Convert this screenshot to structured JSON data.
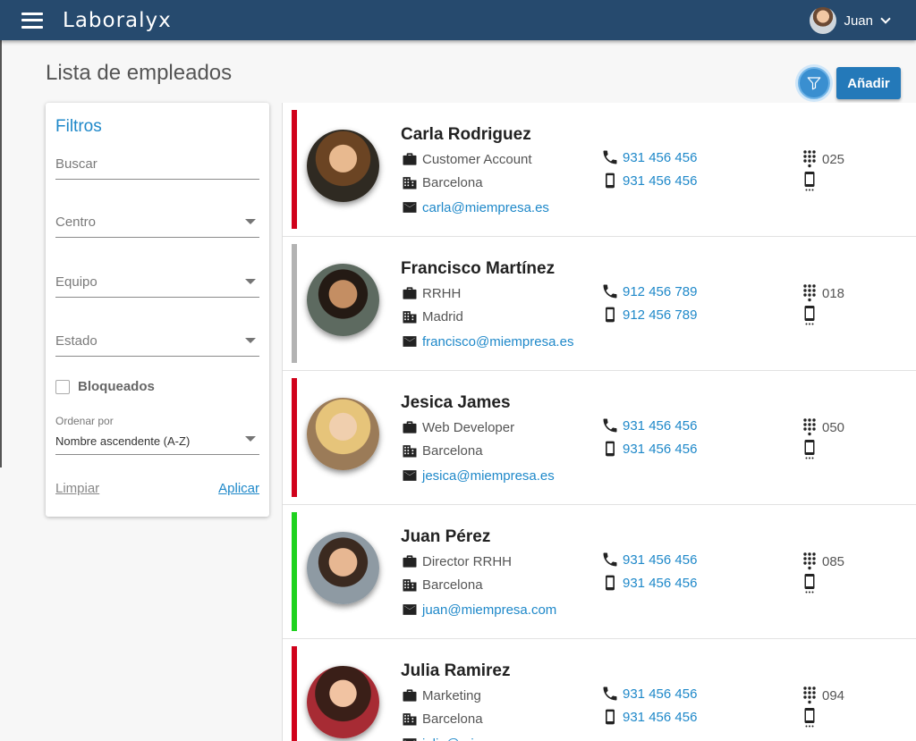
{
  "app": {
    "brand": "Laboralyx"
  },
  "user": {
    "name": "Juan"
  },
  "page": {
    "title": "Lista de empleados"
  },
  "actions": {
    "add_label": "Añadir"
  },
  "filters": {
    "title": "Filtros",
    "search_placeholder": "Buscar",
    "centro_placeholder": "Centro",
    "equipo_placeholder": "Equipo",
    "estado_placeholder": "Estado",
    "blocked_label": "Bloqueados",
    "sort_label": "Ordenar por",
    "sort_value": "Nombre ascendente (A-Z)",
    "clear_label": "Limpiar",
    "apply_label": "Aplicar"
  },
  "employees": [
    {
      "name": "Carla Rodriguez",
      "role": "Customer Account",
      "city": "Barcelona",
      "email": "carla@miempresa.es",
      "phone": "931 456 456",
      "mobile": "931 456 456",
      "ext": "025",
      "status_color": "#d0021b"
    },
    {
      "name": "Francisco Martínez",
      "role": "RRHH",
      "city": "Madrid",
      "email": "francisco@miempresa.es",
      "phone": "912 456 789",
      "mobile": "912 456 789",
      "ext": "018",
      "status_color": "#b3b3b3"
    },
    {
      "name": "Jesica James",
      "role": "Web Developer",
      "city": "Barcelona",
      "email": "jesica@miempresa.es",
      "phone": "931 456 456",
      "mobile": "931 456 456",
      "ext": "050",
      "status_color": "#d0021b"
    },
    {
      "name": "Juan Pérez",
      "role": "Director RRHH",
      "city": "Barcelona",
      "email": "juan@miempresa.com",
      "phone": "931 456 456",
      "mobile": "931 456 456",
      "ext": "085",
      "status_color": "#1ed21e"
    },
    {
      "name": "Julia Ramirez",
      "role": "Marketing",
      "city": "Barcelona",
      "email": "julia@miempresa.es",
      "phone": "931 456 456",
      "mobile": "931 456 456",
      "ext": "094",
      "status_color": "#d0021b"
    }
  ]
}
